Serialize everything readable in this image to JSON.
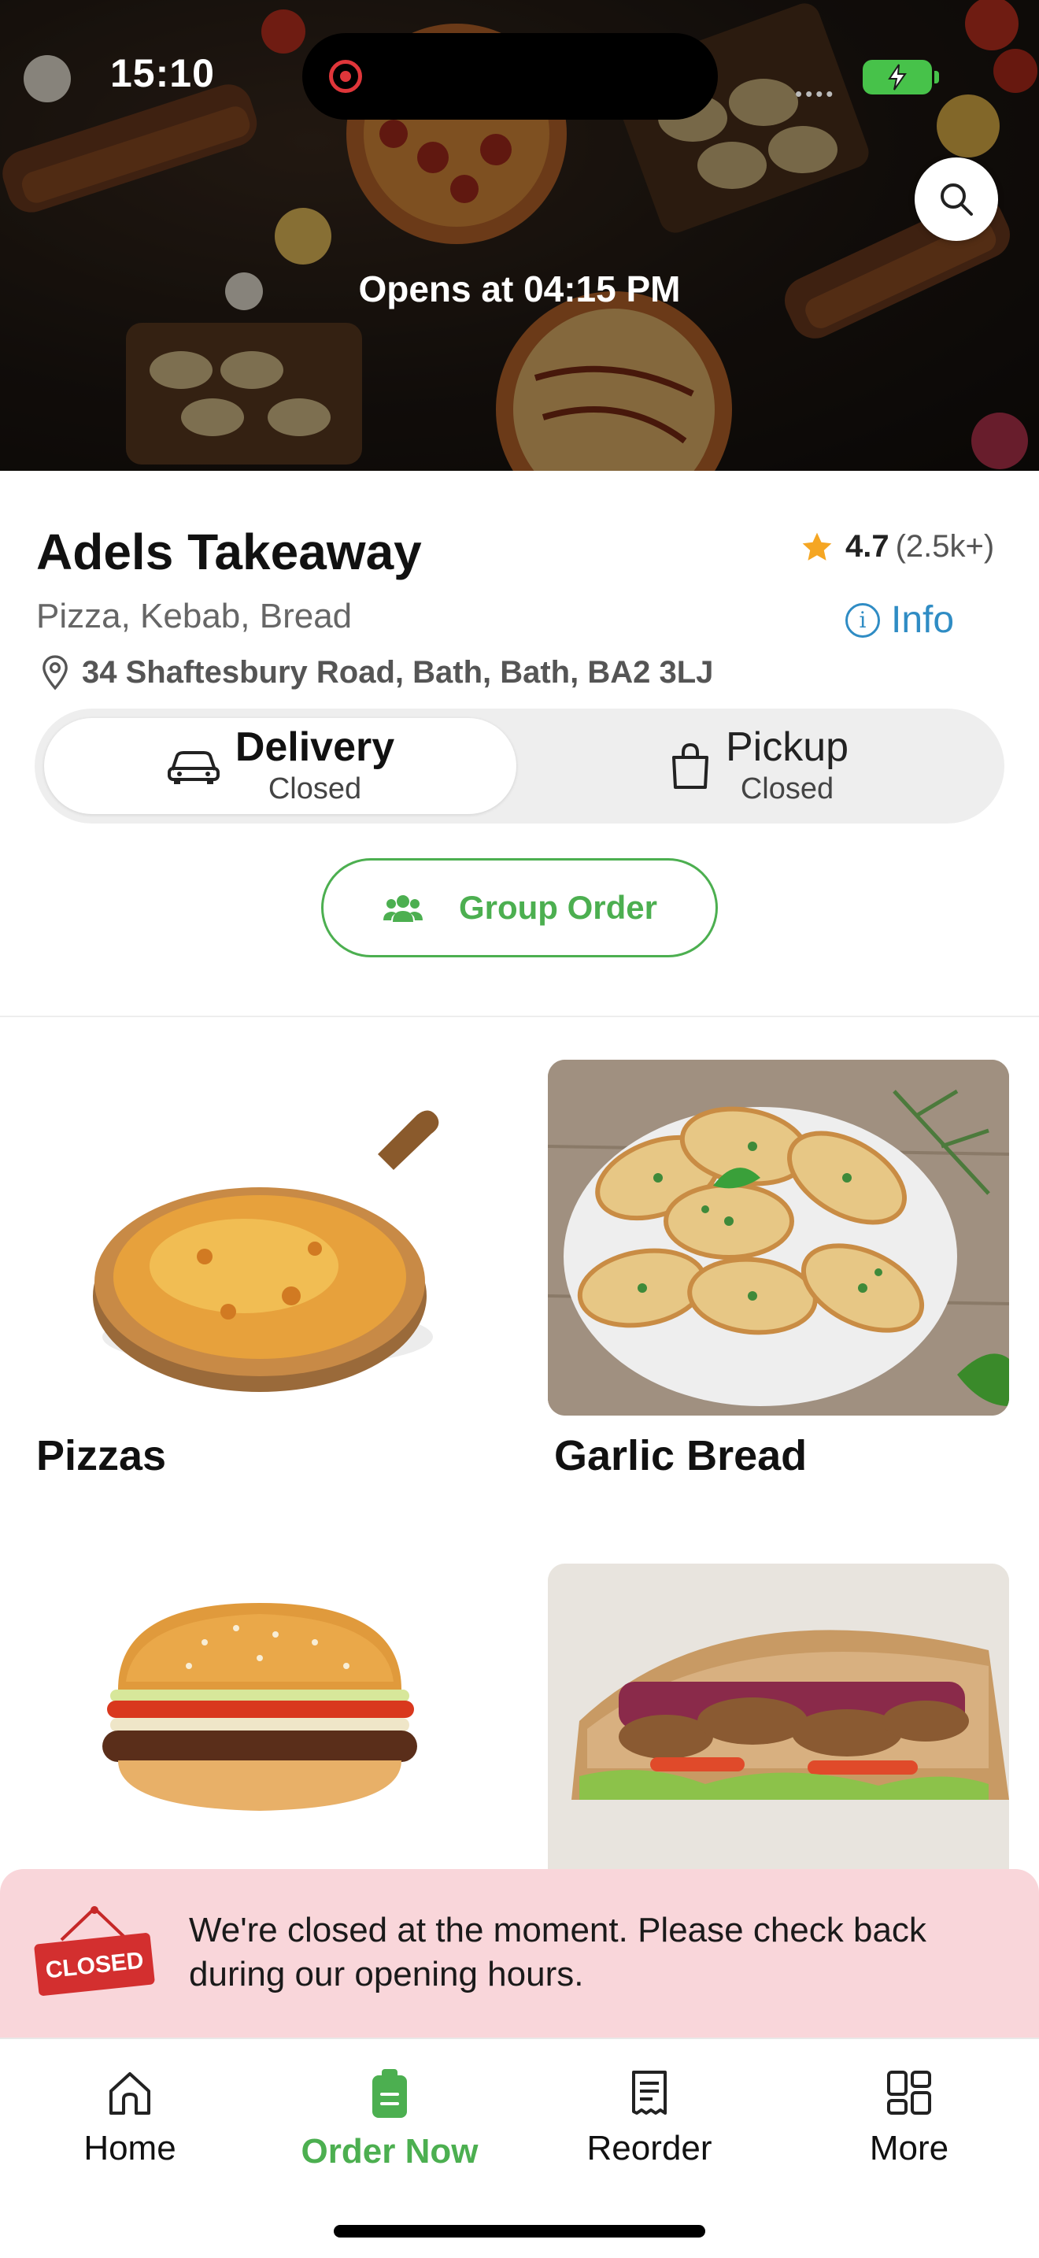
{
  "status_bar": {
    "time": "15:10"
  },
  "hero": {
    "opens_text": "Opens at 04:15 PM",
    "search_icon": "search-icon"
  },
  "restaurant": {
    "name": "Adels Takeaway",
    "rating": "4.7",
    "rating_count": "(2.5k+)",
    "cuisine": "Pizza, Kebab, Bread",
    "info_label": "Info",
    "address": "34 Shaftesbury Road, Bath, Bath, BA2 3LJ"
  },
  "order_mode": {
    "delivery": {
      "label": "Delivery",
      "status": "Closed",
      "selected": true
    },
    "pickup": {
      "label": "Pickup",
      "status": "Closed",
      "selected": false
    }
  },
  "group_order": {
    "label": "Group Order"
  },
  "categories": [
    {
      "name": "Pizzas"
    },
    {
      "name": "Garlic Bread"
    },
    {
      "name": ""
    },
    {
      "name": ""
    }
  ],
  "closed_banner": {
    "sign_text": "CLOSED",
    "message": "We're closed at the moment. Please check back during our opening hours."
  },
  "tabbar": {
    "items": [
      {
        "label": "Home",
        "icon": "home-icon"
      },
      {
        "label": "Order Now",
        "icon": "order-now-icon",
        "active": true
      },
      {
        "label": "Reorder",
        "icon": "receipt-icon"
      },
      {
        "label": "More",
        "icon": "grid-icon"
      }
    ]
  },
  "colors": {
    "accent_green": "#4caf50",
    "link_blue": "#2f8cc4",
    "star": "#f5a623",
    "closed_banner_bg": "#f9d6da"
  }
}
